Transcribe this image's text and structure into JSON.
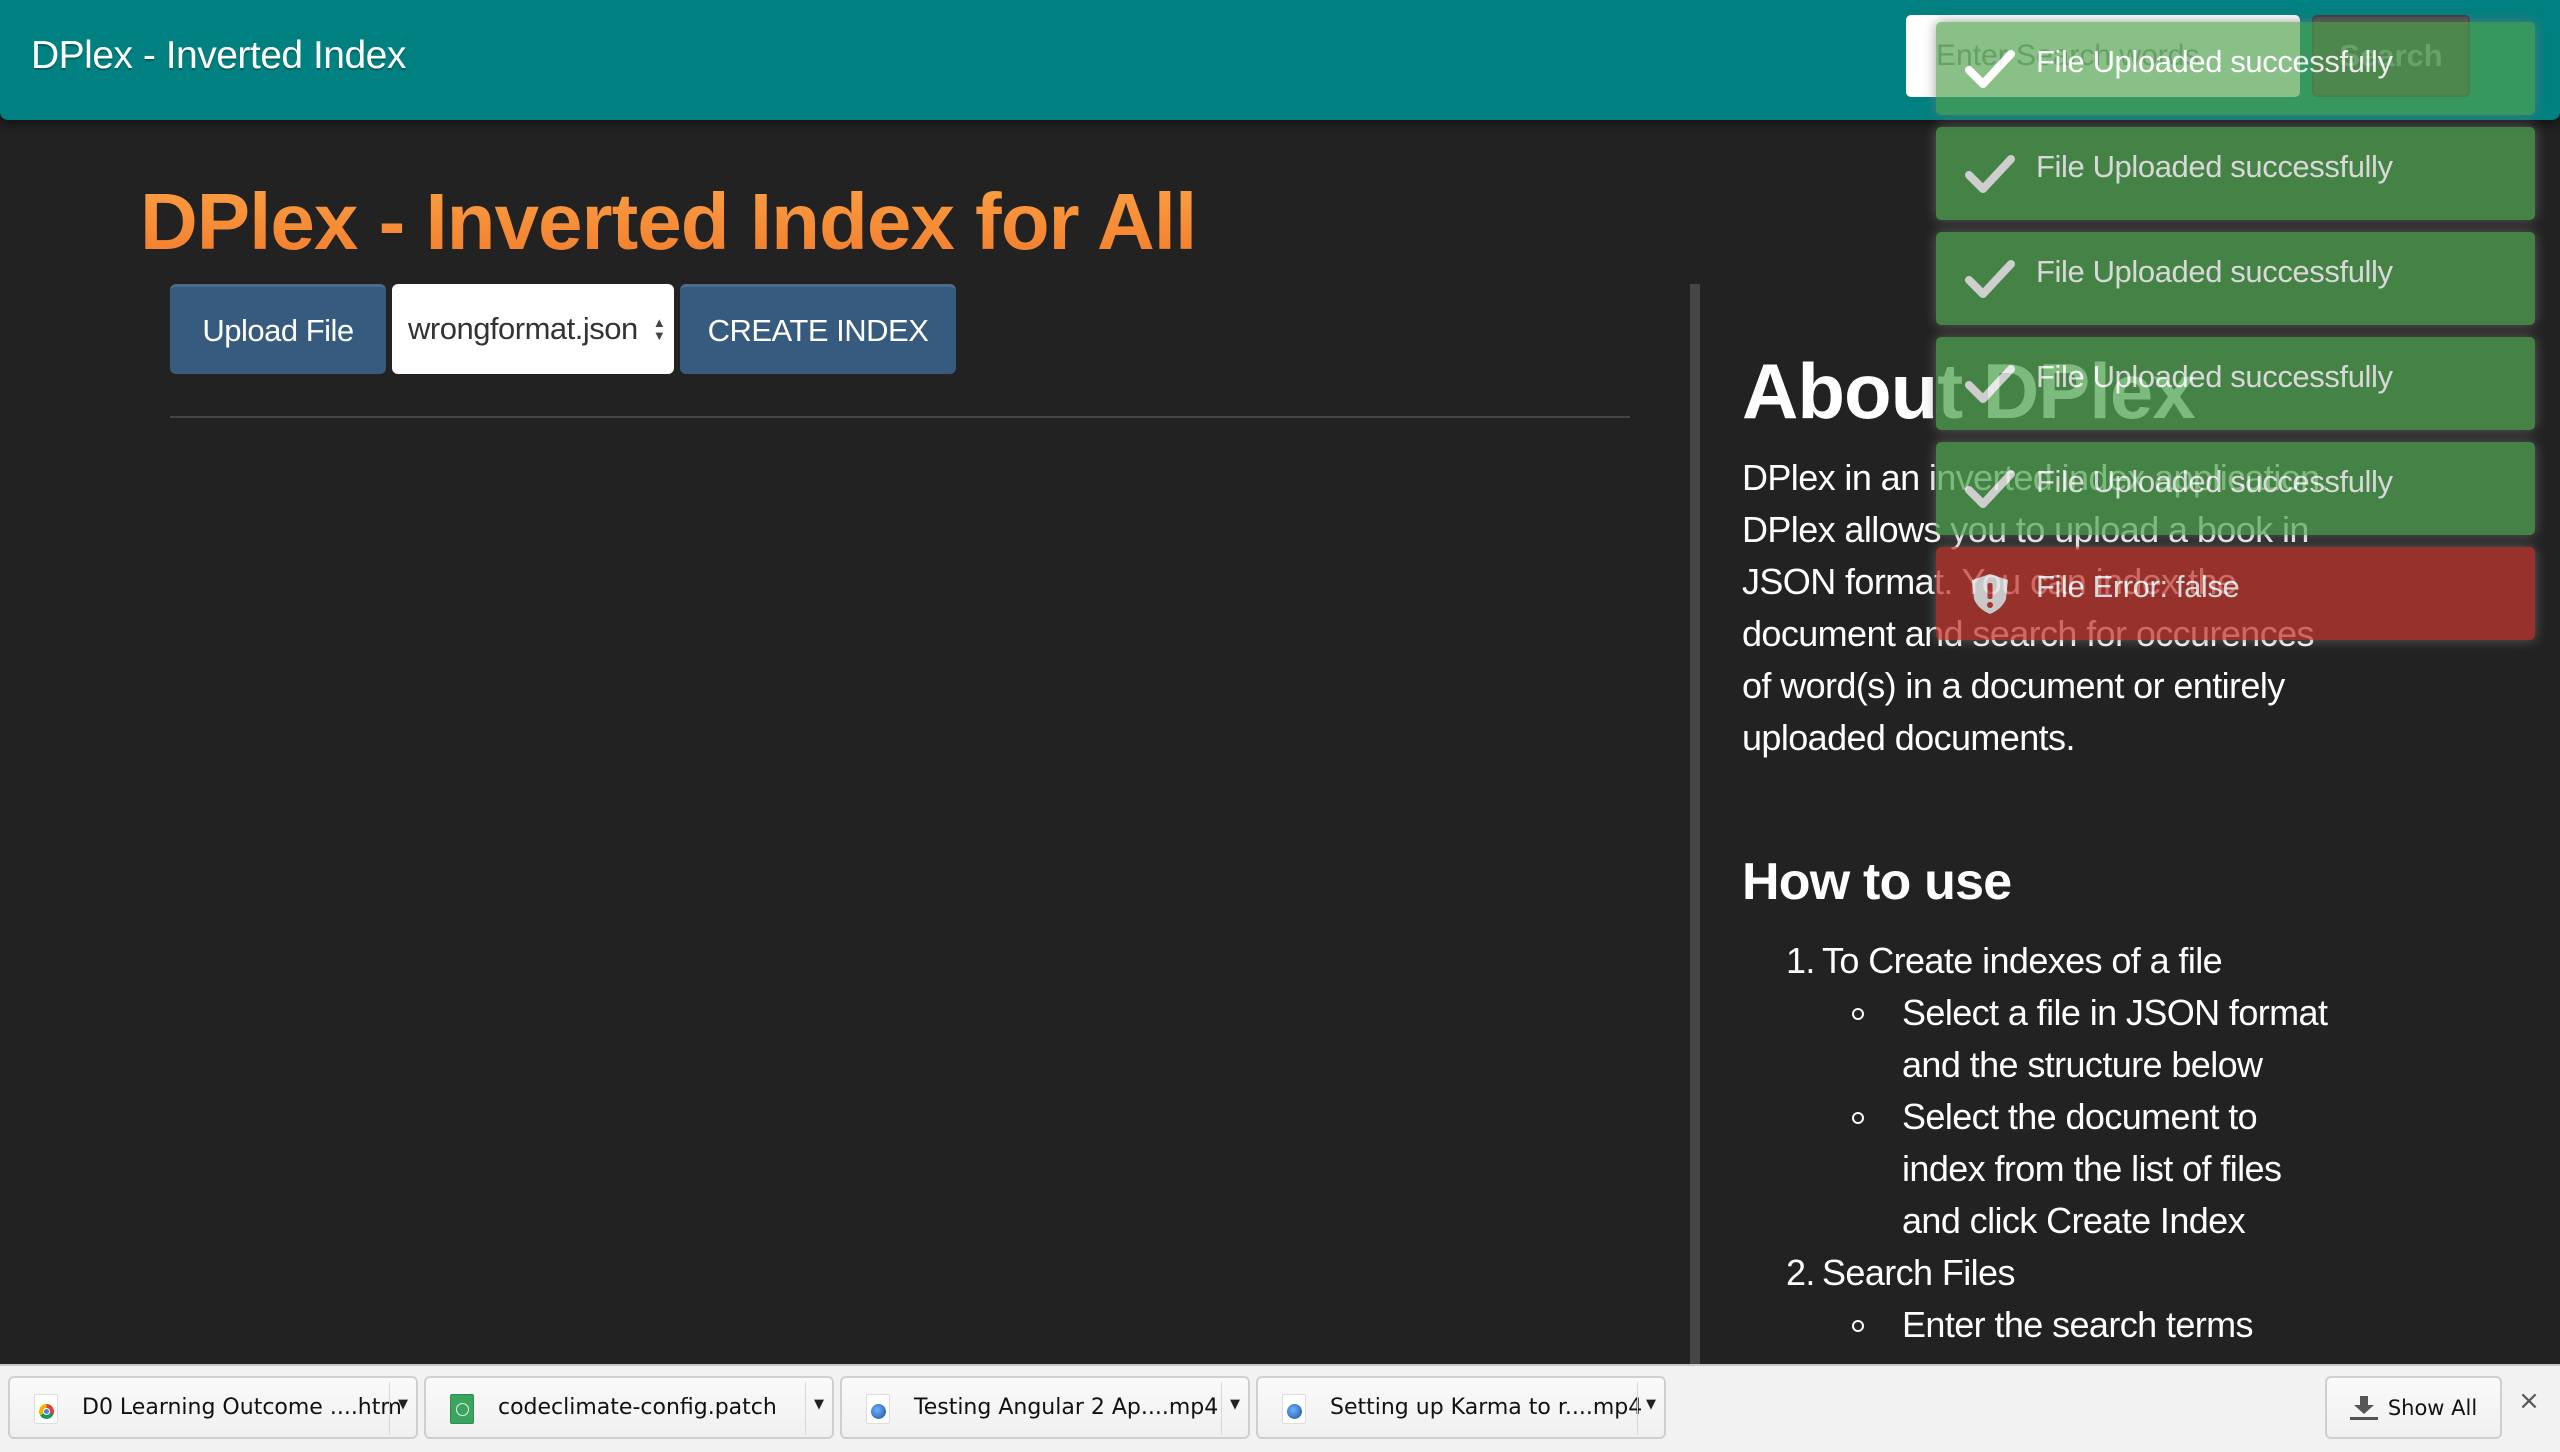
{
  "header": {
    "brand": "DPlex - Inverted Index",
    "search_placeholder": "Enter Search words",
    "search_button": "Search",
    "bg_color": "#008080"
  },
  "main": {
    "title": "DPlex - Inverted Index for All",
    "upload_button": "Upload File",
    "selected_file": "wrongformat.json",
    "create_index_button": "CREATE INDEX",
    "button_color": "#375a7f",
    "title_color": "#f7892f"
  },
  "about": {
    "title": "About DPlex",
    "text": "DPlex in an inverted index application. DPlex allows you to upload a book in JSON format. You can index the document and search for occurences of word(s) in a document or entirely uploaded documents.",
    "howto_title": "How to use",
    "steps": [
      {
        "number": "1.",
        "label": "To Create indexes of a file",
        "substeps": [
          "Select a file in JSON format and the structure below",
          "Select the document to index from the list of files and click Create Index"
        ]
      },
      {
        "number": "2.",
        "label": "Search Files",
        "substeps": [
          "Enter the search terms"
        ]
      }
    ]
  },
  "toasts": [
    {
      "type": "success",
      "icon": "check-icon",
      "message": "File Uploaded successfully"
    },
    {
      "type": "success",
      "icon": "check-icon",
      "message": "File Uploaded successfully"
    },
    {
      "type": "success",
      "icon": "check-icon",
      "message": "File Uploaded successfully"
    },
    {
      "type": "success",
      "icon": "check-icon",
      "message": "File Uploaded successfully"
    },
    {
      "type": "success",
      "icon": "check-icon",
      "message": "File Uploaded successfully"
    },
    {
      "type": "error",
      "icon": "shield-alert-icon",
      "message": "File Error: false"
    }
  ],
  "toast_colors": {
    "success": "#51a351",
    "error": "#bd362f"
  },
  "downloads": {
    "items": [
      {
        "name": "D0 Learning Outcome ....htm",
        "icon": "chrome-file-icon"
      },
      {
        "name": "codeclimate-config.patch",
        "icon": "atom-file-icon"
      },
      {
        "name": "Testing Angular 2 Ap....mp4",
        "icon": "quicktime-file-icon"
      },
      {
        "name": "Setting up Karma to r....mp4",
        "icon": "quicktime-file-icon"
      }
    ],
    "show_all": "Show All",
    "close": "×"
  }
}
